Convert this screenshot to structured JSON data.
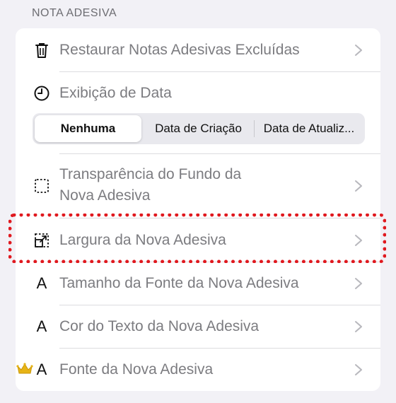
{
  "section": {
    "title": "NOTA ADESIVA"
  },
  "rows": {
    "restore": {
      "label": "Restaurar Notas Adesivas Excluídas",
      "icon": "trash-icon"
    },
    "date_display": {
      "label": "Exibição de Data",
      "icon": "clock-icon"
    },
    "transparency": {
      "line1": "Transparência do Fundo da",
      "line2": "Nova Adesiva",
      "icon": "dotted-square-icon"
    },
    "width": {
      "label": "Largura da Nova Adesiva",
      "icon": "resize-icon"
    },
    "font_size": {
      "label": "Tamanho da Fonte da Nova Adesiva",
      "icon": "A",
      "icon_name": "letter-a-icon"
    },
    "text_color": {
      "label": "Cor do Texto da Nova Adesiva",
      "icon": "A",
      "icon_name": "letter-a-icon"
    },
    "font": {
      "label": "Fonte da Nova Adesiva",
      "icon": "A",
      "icon_name": "letter-a-icon",
      "badge_icon": "crown-icon"
    }
  },
  "date_segment": {
    "options": [
      "Nenhuma",
      "Data de Criação",
      "Data de Atualiz..."
    ],
    "selected": "Nenhuma"
  },
  "colors": {
    "highlight": "#e0191f",
    "crown": "#e7b416",
    "label": "#7c7c80"
  }
}
